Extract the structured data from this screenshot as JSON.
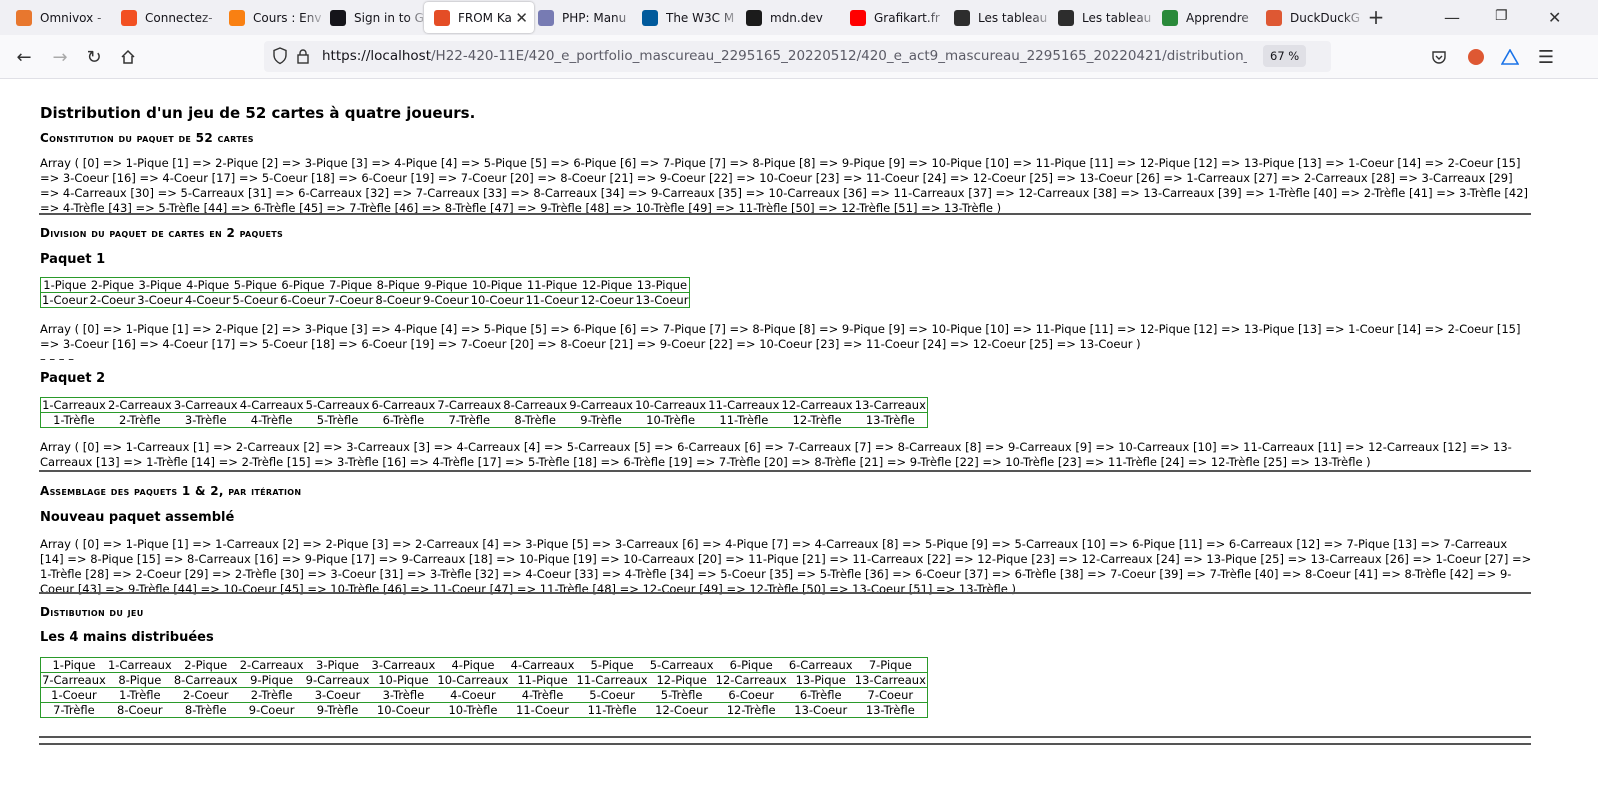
{
  "browser": {
    "tabs": [
      {
        "label": "Omnivox -",
        "icon": "omnivox-icon",
        "color": "#e8772e"
      },
      {
        "label": "Connectez-",
        "icon": "microsoft-icon",
        "color": "#f25022"
      },
      {
        "label": "Cours : Env",
        "icon": "moodle-icon",
        "color": "#f98012"
      },
      {
        "label": "Sign in to G",
        "icon": "github-icon",
        "color": "#15141a"
      },
      {
        "label": "FROM Ka",
        "icon": "html-icon",
        "color": "#e44d26"
      },
      {
        "label": "PHP: Manu",
        "icon": "php-icon",
        "color": "#777bb3"
      },
      {
        "label": "The W3C M",
        "icon": "w3c-icon",
        "color": "#005a9c"
      },
      {
        "label": "mdn.dev",
        "icon": "mdn-icon",
        "color": "#1b1b1b"
      },
      {
        "label": "Grafikart.fr",
        "icon": "youtube-icon",
        "color": "#ff0000"
      },
      {
        "label": "Les tableau",
        "icon": "w3schools-icon",
        "color": "#2d2d2d"
      },
      {
        "label": "Les tableau",
        "icon": "w3schools-icon",
        "color": "#2d2d2d"
      },
      {
        "label": "Apprendre",
        "icon": "globe-icon",
        "color": "#2a8a3a"
      },
      {
        "label": "DuckDuckG",
        "icon": "duckduckgo-icon",
        "color": "#de5833"
      }
    ],
    "url_host": "https://localhost",
    "url_path": "/H22-420-11E/420_e_portfolio_mascureau_2295165_20220512/420_e_act9_mascureau_2295165_20220421/distribution_52cartes_ite",
    "zoom": "67 %"
  },
  "page": {
    "title": "Distribution d'un jeu de 52 cartes à quatre joueurs.",
    "section1_title": "Constitution du paquet de 52 cartes",
    "section1_array": "Array ( [0] => 1-Pique [1] => 2-Pique [2] => 3-Pique [3] => 4-Pique [4] => 5-Pique [5] => 6-Pique [6] => 7-Pique [7] => 8-Pique [8] => 9-Pique [9] => 10-Pique [10] => 11-Pique [11] => 12-Pique [12] => 13-Pique [13] => 1-Coeur [14] => 2-Coeur [15] => 3-Coeur [16] => 4-Coeur [17] => 5-Coeur [18] => 6-Coeur [19] => 7-Coeur [20] => 8-Coeur [21] => 9-Coeur [22] => 10-Coeur [23] => 11-Coeur [24] => 12-Coeur [25] => 13-Coeur [26] => 1-Carreaux [27] => 2-Carreaux [28] => 3-Carreaux [29] => 4-Carreaux [30] => 5-Carreaux [31] => 6-Carreaux [32] => 7-Carreaux [33] => 8-Carreaux [34] => 9-Carreaux [35] => 10-Carreaux [36] => 11-Carreaux [37] => 12-Carreaux [38] => 13-Carreaux [39] => 1-Trèfle [40] => 2-Trèfle [41] => 3-Trèfle [42] => 4-Trèfle [43] => 5-Trèfle [44] => 6-Trèfle [45] => 7-Trèfle [46] => 8-Trèfle [47] => 9-Trèfle [48] => 10-Trèfle [49] => 11-Trèfle [50] => 12-Trèfle [51] => 13-Trèfle )",
    "section2_title": "Division du paquet de cartes en 2 paquets",
    "paquet1_title": "Paquet 1",
    "paquet1_rows": [
      [
        "1-Pique",
        "2-Pique",
        "3-Pique",
        "4-Pique",
        "5-Pique",
        "6-Pique",
        "7-Pique",
        "8-Pique",
        "9-Pique",
        "10-Pique",
        "11-Pique",
        "12-Pique",
        "13-Pique"
      ],
      [
        "1-Coeur",
        "2-Coeur",
        "3-Coeur",
        "4-Coeur",
        "5-Coeur",
        "6-Coeur",
        "7-Coeur",
        "8-Coeur",
        "9-Coeur",
        "10-Coeur",
        "11-Coeur",
        "12-Coeur",
        "13-Coeur"
      ]
    ],
    "paquet1_array": "Array ( [0] => 1-Pique [1] => 2-Pique [2] => 3-Pique [3] => 4-Pique [4] => 5-Pique [5] => 6-Pique [6] => 7-Pique [7] => 8-Pique [8] => 9-Pique [9] => 10-Pique [10] => 11-Pique [11] => 12-Pique [12] => 13-Pique [13] => 1-Coeur [14] => 2-Coeur [15] => 3-Coeur [16] => 4-Coeur [17] => 5-Coeur [18] => 6-Coeur [19] => 7-Coeur [20] => 8-Coeur [21] => 9-Coeur [22] => 10-Coeur [23] => 11-Coeur [24] => 12-Coeur [25] => 13-Coeur )",
    "separator_dashes": "– – – –",
    "paquet2_title": "Paquet 2",
    "paquet2_rows": [
      [
        "1-Carreaux",
        "2-Carreaux",
        "3-Carreaux",
        "4-Carreaux",
        "5-Carreaux",
        "6-Carreaux",
        "7-Carreaux",
        "8-Carreaux",
        "9-Carreaux",
        "10-Carreaux",
        "11-Carreaux",
        "12-Carreaux",
        "13-Carreaux"
      ],
      [
        "1-Trèfle",
        "2-Trèfle",
        "3-Trèfle",
        "4-Trèfle",
        "5-Trèfle",
        "6-Trèfle",
        "7-Trèfle",
        "8-Trèfle",
        "9-Trèfle",
        "10-Trèfle",
        "11-Trèfle",
        "12-Trèfle",
        "13-Trèfle"
      ]
    ],
    "paquet2_array": "Array ( [0] => 1-Carreaux [1] => 2-Carreaux [2] => 3-Carreaux [3] => 4-Carreaux [4] => 5-Carreaux [5] => 6-Carreaux [6] => 7-Carreaux [7] => 8-Carreaux [8] => 9-Carreaux [9] => 10-Carreaux [10] => 11-Carreaux [11] => 12-Carreaux [12] => 13-Carreaux [13] => 1-Trèfle [14] => 2-Trèfle [15] => 3-Trèfle [16] => 4-Trèfle [17] => 5-Trèfle [18] => 6-Trèfle [19] => 7-Trèfle [20] => 8-Trèfle [21] => 9-Trèfle [22] => 10-Trèfle [23] => 11-Trèfle [24] => 12-Trèfle [25] => 13-Trèfle )",
    "section3_title": "Assemblage des paquets 1 & 2, par itération",
    "assembled_title": "Nouveau paquet assemblé",
    "assembled_array": "Array ( [0] => 1-Pique [1] => 1-Carreaux [2] => 2-Pique [3] => 2-Carreaux [4] => 3-Pique [5] => 3-Carreaux [6] => 4-Pique [7] => 4-Carreaux [8] => 5-Pique [9] => 5-Carreaux [10] => 6-Pique [11] => 6-Carreaux [12] => 7-Pique [13] => 7-Carreaux [14] => 8-Pique [15] => 8-Carreaux [16] => 9-Pique [17] => 9-Carreaux [18] => 10-Pique [19] => 10-Carreaux [20] => 11-Pique [21] => 11-Carreaux [22] => 12-Pique [23] => 12-Carreaux [24] => 13-Pique [25] => 13-Carreaux [26] => 1-Coeur [27] => 1-Trèfle [28] => 2-Coeur [29] => 2-Trèfle [30] => 3-Coeur [31] => 3-Trèfle [32] => 4-Coeur [33] => 4-Trèfle [34] => 5-Coeur [35] => 5-Trèfle [36] => 6-Coeur [37] => 6-Trèfle [38] => 7-Coeur [39] => 7-Trèfle [40] => 8-Coeur [41] => 8-Trèfle [42] => 9-Coeur [43] => 9-Trèfle [44] => 10-Coeur [45] => 10-Trèfle [46] => 11-Coeur [47] => 11-Trèfle [48] => 12-Coeur [49] => 12-Trèfle [50] => 13-Coeur [51] => 13-Trèfle )",
    "section4_title": "Distibution du jeu",
    "hands_title": "Les 4 mains distribuées",
    "hands_rows": [
      [
        "1-Pique",
        "1-Carreaux",
        "2-Pique",
        "2-Carreaux",
        "3-Pique",
        "3-Carreaux",
        "4-Pique",
        "4-Carreaux",
        "5-Pique",
        "5-Carreaux",
        "6-Pique",
        "6-Carreaux",
        "7-Pique"
      ],
      [
        "7-Carreaux",
        "8-Pique",
        "8-Carreaux",
        "9-Pique",
        "9-Carreaux",
        "10-Pique",
        "10-Carreaux",
        "11-Pique",
        "11-Carreaux",
        "12-Pique",
        "12-Carreaux",
        "13-Pique",
        "13-Carreaux"
      ],
      [
        "1-Coeur",
        "1-Trèfle",
        "2-Coeur",
        "2-Trèfle",
        "3-Coeur",
        "3-Trèfle",
        "4-Coeur",
        "4-Trèfle",
        "5-Coeur",
        "5-Trèfle",
        "6-Coeur",
        "6-Trèfle",
        "7-Coeur"
      ],
      [
        "7-Trèfle",
        "8-Coeur",
        "8-Trèfle",
        "9-Coeur",
        "9-Trèfle",
        "10-Coeur",
        "10-Trèfle",
        "11-Coeur",
        "11-Trèfle",
        "12-Coeur",
        "12-Trèfle",
        "13-Coeur",
        "13-Trèfle"
      ]
    ]
  }
}
